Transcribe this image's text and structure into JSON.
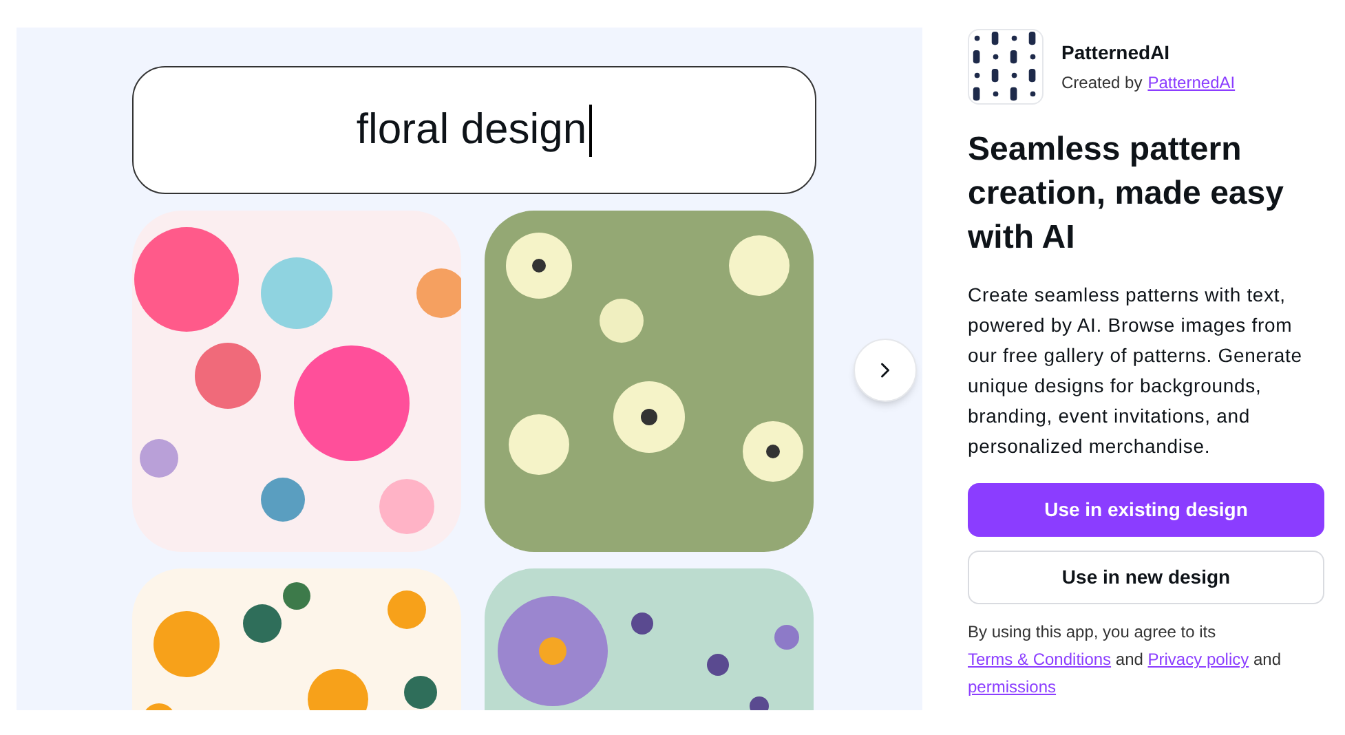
{
  "preview": {
    "prompt_field": {
      "value": "floral design"
    }
  },
  "app": {
    "name": "PatternedAI",
    "created_by": "Created by",
    "creator_link": "PatternedAI",
    "heading": "Seamless pattern creation, made easy with AI",
    "description": "Create seamless patterns with text, powered by AI. Browse images from our free gallery of patterns. Generate unique designs for backgrounds, branding, event invitations, and personalized merchandise.",
    "buttons": [
      {
        "label": "Use in existing design",
        "kind": "primary"
      },
      {
        "label": "Use in new design",
        "kind": "secondary"
      }
    ],
    "legal": [
      {
        "kind": "text",
        "text": "By using this app, you agree to its"
      },
      {
        "kind": "link",
        "text": "Terms & Conditions"
      },
      {
        "kind": "text",
        "text": "and"
      },
      {
        "kind": "link",
        "text": "Privacy policy"
      },
      {
        "kind": "text",
        "text": "and"
      },
      {
        "kind": "link",
        "text": "permissions"
      }
    ]
  }
}
